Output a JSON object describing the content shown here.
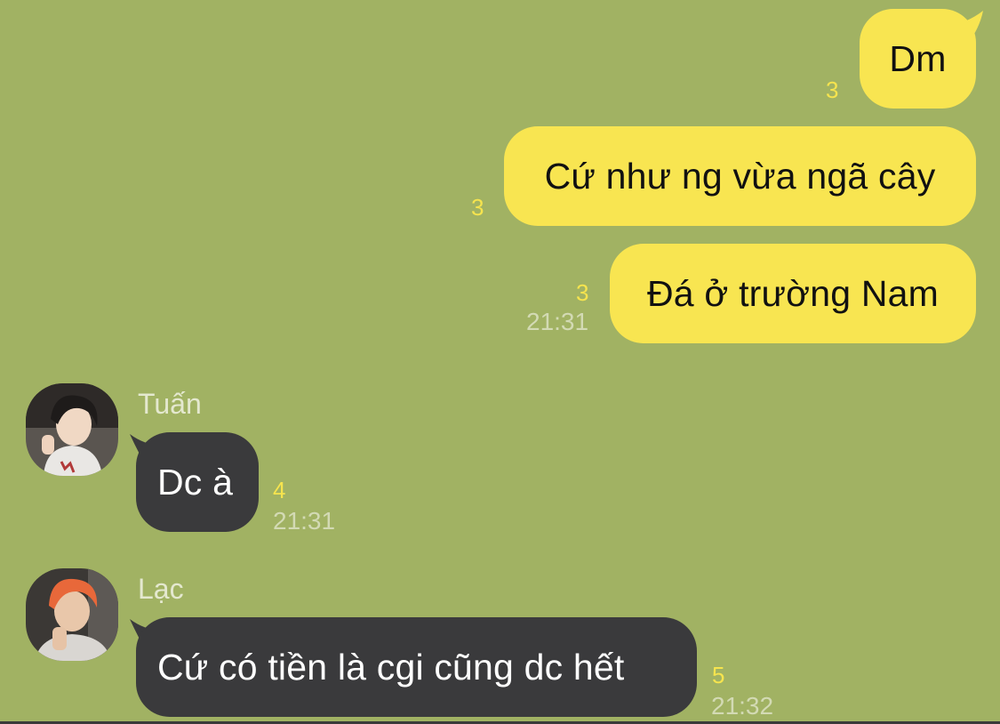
{
  "chat": {
    "messages": [
      {
        "text": "Dm",
        "read_count": "3"
      },
      {
        "text": "Cứ như ng vừa ngã cây",
        "read_count": "3"
      },
      {
        "text": "Đá ở trường Nam",
        "read_count": "3",
        "time": "21:31"
      },
      {
        "sender": "Tuấn",
        "text": "Dc à",
        "read_count": "4",
        "time": "21:31"
      },
      {
        "sender": "Lạc",
        "text": "Cứ có tiền là cgi cũng dc hết",
        "read_count": "5",
        "time": "21:32"
      }
    ]
  },
  "colors": {
    "background": "#a1b263",
    "outgoing_bubble": "#f8e551",
    "incoming_bubble": "#3a3a3c",
    "read_count": "#f6e44e"
  },
  "icons": {
    "avatar_tuan": "avatar-photo",
    "avatar_lac": "avatar-photo"
  }
}
